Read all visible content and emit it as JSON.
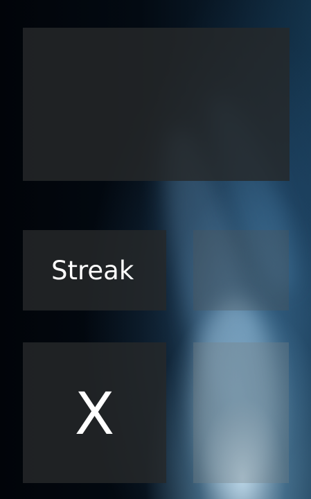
{
  "tiles": {
    "streak_label": "Streak",
    "result_symbol": "X"
  }
}
